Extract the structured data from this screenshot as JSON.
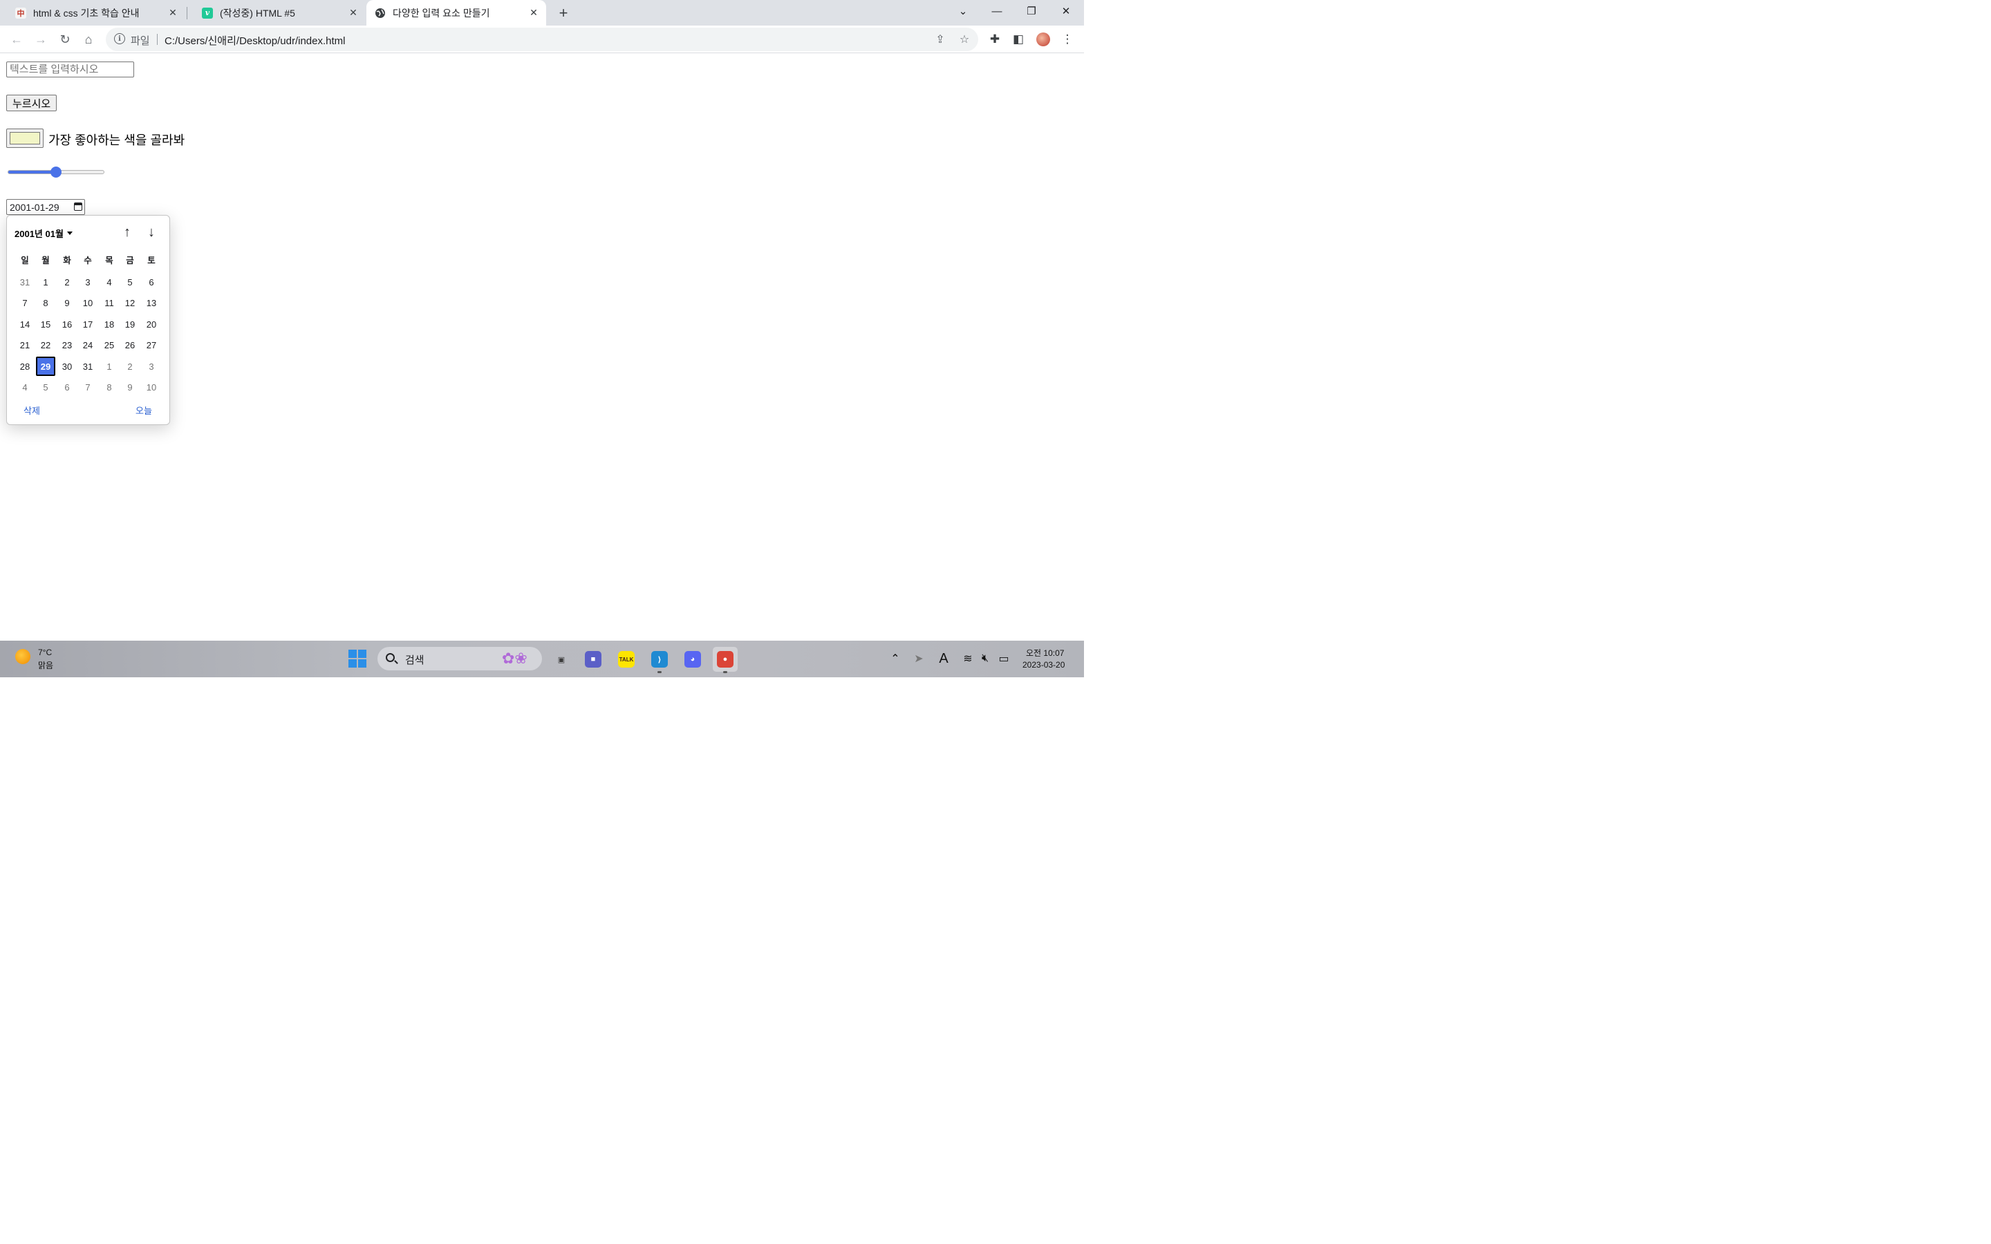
{
  "browser": {
    "tabs": [
      {
        "title": "html & css 기초 학습 안내",
        "favicon": "red-chinese-character-icon",
        "favicon_glyph": "中",
        "active": false
      },
      {
        "title": "(작성중) HTML #5",
        "favicon": "velog-v-icon",
        "favicon_glyph": "v",
        "active": false
      },
      {
        "title": "다양한 입력 요소 만들기",
        "favicon": "globe-icon",
        "favicon_glyph": "🌐",
        "active": true
      }
    ],
    "address": {
      "scheme_label": "파일",
      "url": "C:/Users/신애리/Desktop/udr/index.html"
    }
  },
  "page": {
    "text_input": {
      "placeholder": "텍스트를 입력하시오",
      "value": ""
    },
    "button_label": "누르시오",
    "color_input": {
      "value": "#f2f5c6"
    },
    "color_label": "가장 좋아하는 색을 골라봐",
    "range_input": {
      "value_fraction": 0.5
    },
    "date_input": {
      "value": "2001-01-29"
    },
    "date_picker": {
      "month_label": "2001년 01월",
      "weekdays": [
        "일",
        "월",
        "화",
        "수",
        "목",
        "금",
        "토"
      ],
      "weeks": [
        [
          "31",
          "1",
          "2",
          "3",
          "4",
          "5",
          "6"
        ],
        [
          "7",
          "8",
          "9",
          "10",
          "11",
          "12",
          "13"
        ],
        [
          "14",
          "15",
          "16",
          "17",
          "18",
          "19",
          "20"
        ],
        [
          "21",
          "22",
          "23",
          "24",
          "25",
          "26",
          "27"
        ],
        [
          "28",
          "29",
          "30",
          "31",
          "1",
          "2",
          "3"
        ],
        [
          "4",
          "5",
          "6",
          "7",
          "8",
          "9",
          "10"
        ]
      ],
      "selected_day": "29",
      "clear_label": "삭제",
      "today_label": "오늘"
    }
  },
  "taskbar": {
    "weather": {
      "temp": "7°C",
      "desc": "맑음"
    },
    "search_label": "검색",
    "apps": [
      {
        "name": "task-view-icon",
        "glyph": "▣",
        "color": "#3a3a3a",
        "bg": "transparent",
        "active": false
      },
      {
        "name": "teams-chat-icon",
        "glyph": "■",
        "color": "#ffffff",
        "bg": "#5b5fc7",
        "active": false
      },
      {
        "name": "kakaotalk-icon",
        "glyph": "TALK",
        "color": "#3b1e1e",
        "bg": "#fee500",
        "active": false
      },
      {
        "name": "vscode-icon",
        "glyph": "⟩",
        "color": "#ffffff",
        "bg": "#1f8ad2",
        "active": false
      },
      {
        "name": "discord-icon",
        "glyph": "◕",
        "color": "#ffffff",
        "bg": "#5865f2",
        "active": false
      },
      {
        "name": "chrome-icon",
        "glyph": "●",
        "color": "#ffffff",
        "bg": "#db4437",
        "active": true
      }
    ],
    "clock": {
      "time": "오전 10:07",
      "date": "2023-03-20"
    }
  }
}
